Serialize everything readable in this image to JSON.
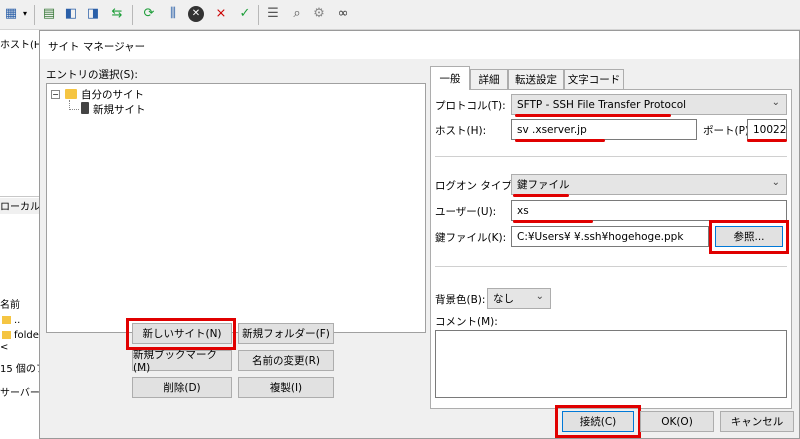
{
  "toolbar": {
    "icons": [
      "site-manager-icon",
      "dropdown-arrow-icon",
      "message-log-icon",
      "local-tree-icon",
      "remote-tree-icon",
      "transfer-queue-icon",
      "refresh-icon",
      "filter-icon",
      "cancel-icon",
      "disconnect-icon",
      "reconnect-icon",
      "compare-icon",
      "search-icon",
      "binoculars-icon"
    ]
  },
  "background": {
    "host_label": "ホスト(H):",
    "local_label": "ローカル サ",
    "name_header": "名前",
    "row_dotdot": "..",
    "row_folder": "folde",
    "count_text": "15 個のフ",
    "server_label": "サーバー/"
  },
  "dialog": {
    "title": "サイト マネージャー",
    "entry_label": "エントリの選択(S):",
    "tree": {
      "root": "自分のサイト",
      "child": "新規サイト"
    },
    "buttons": {
      "new_site": "新しいサイト(N)",
      "new_folder": "新規フォルダー(F)",
      "new_bookmark": "新規ブックマーク(M)",
      "rename": "名前の変更(R)",
      "delete": "削除(D)",
      "duplicate": "複製(I)",
      "connect": "接続(C)",
      "ok": "OK(O)",
      "cancel": "キャンセル"
    },
    "tabs": [
      "一般",
      "詳細",
      "転送設定",
      "文字コード"
    ],
    "general": {
      "protocol_label": "プロトコル(T):",
      "protocol_value": "SFTP - SSH File Transfer Protocol",
      "host_label": "ホスト(H):",
      "host_value": "sv        .xserver.jp",
      "port_label": "ポート(P):",
      "port_value": "10022",
      "logon_label": "ログオン タイプ(L):",
      "logon_value": "鍵ファイル",
      "user_label": "ユーザー(U):",
      "user_value": "xs",
      "keyfile_label": "鍵ファイル(K):",
      "keyfile_value": "C:¥Users¥              ¥.ssh¥hogehoge.ppk",
      "browse_button": "参照...",
      "bgcolor_label": "背景色(B):",
      "bgcolor_value": "なし",
      "comment_label": "コメント(M):"
    }
  },
  "colors": {
    "highlight": "#e00000",
    "accent": "#0078d7"
  }
}
